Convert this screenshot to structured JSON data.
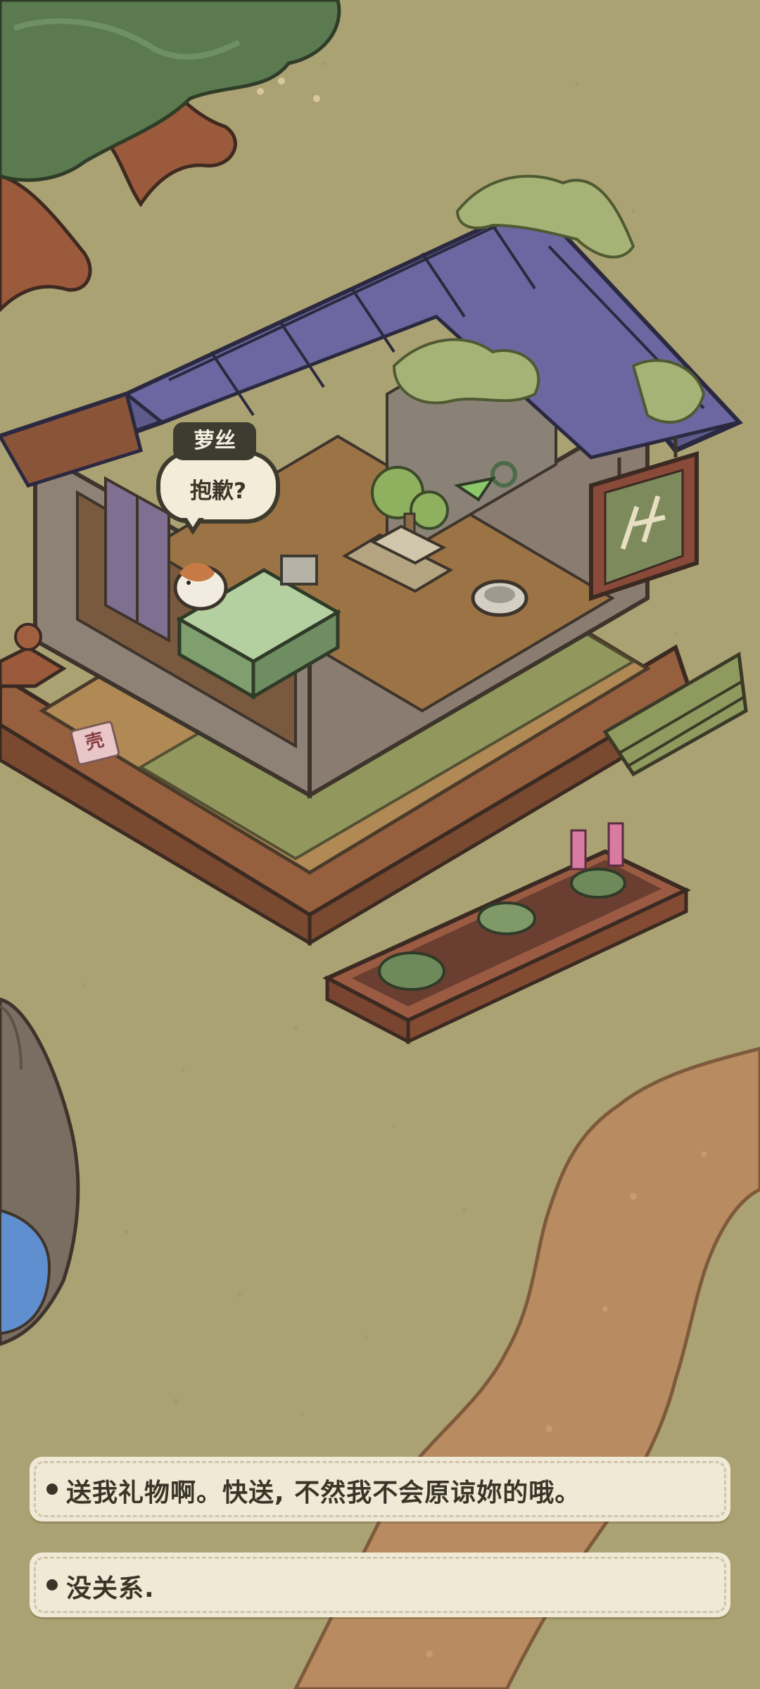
{
  "npc": {
    "name": "萝丝",
    "speech": "抱歉?"
  },
  "shop_sign": {
    "price_tag": "壳"
  },
  "dialogue_options": [
    {
      "text": "送我礼物啊。快送, 不然我不会原谅妳的哦。"
    },
    {
      "text": "没关系."
    }
  ],
  "colors": {
    "grass": "#aba273",
    "path": "#b98b61",
    "roof": "#5e5a8a",
    "water": "#5f8fcf",
    "option_bg": "#efe9d5"
  }
}
